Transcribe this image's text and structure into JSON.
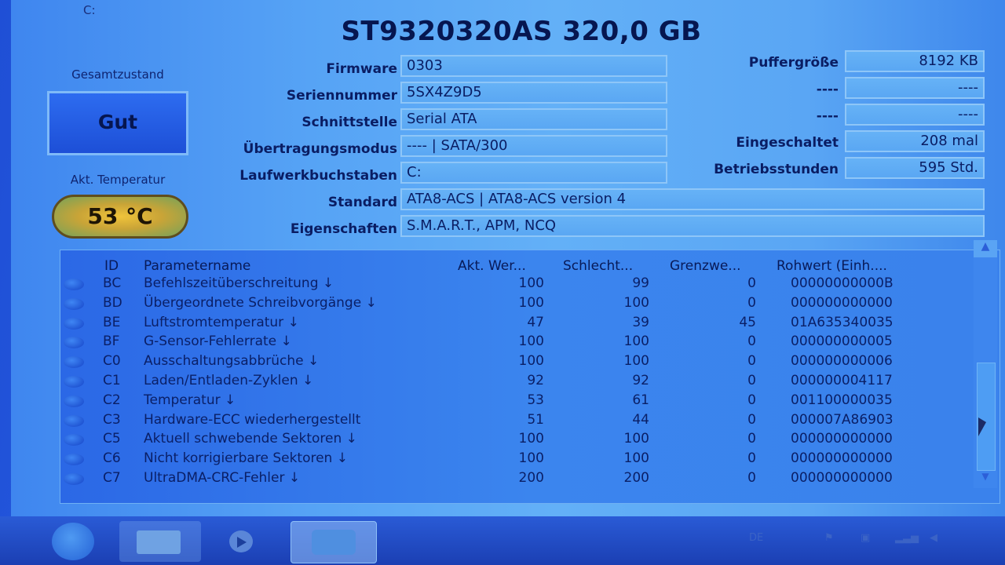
{
  "window": {
    "drive_letter_tab": "C:"
  },
  "drive": {
    "title": "ST9320320AS 320,0 GB"
  },
  "health": {
    "label": "Gesamtzustand",
    "status": "Gut"
  },
  "temperature": {
    "label": "Akt. Temperatur",
    "value": "53 °C"
  },
  "info": {
    "firmware": {
      "label": "Firmware",
      "value": "0303"
    },
    "serial": {
      "label": "Seriennummer",
      "value": "5SX4Z9D5"
    },
    "interface": {
      "label": "Schnittstelle",
      "value": "Serial ATA"
    },
    "transfer_mode": {
      "label": "Übertragungsmodus",
      "value": "---- | SATA/300"
    },
    "drive_letters": {
      "label": "Laufwerkbuchstaben",
      "value": "C:"
    },
    "standard": {
      "label": "Standard",
      "value": "ATA8-ACS | ATA8-ACS version 4"
    },
    "features": {
      "label": "Eigenschaften",
      "value": "S.M.A.R.T., APM, NCQ"
    }
  },
  "info_right": {
    "buffer": {
      "label": "Puffergröße",
      "value": "8192 KB"
    },
    "blank1": {
      "label": "----",
      "value": "----"
    },
    "blank2": {
      "label": "----",
      "value": "----"
    },
    "power_on_count": {
      "label": "Eingeschaltet",
      "value": "208 mal"
    },
    "power_on_hours": {
      "label": "Betriebsstunden",
      "value": "595 Std."
    }
  },
  "smart": {
    "headers": {
      "id": "ID",
      "name": "Parametername",
      "current": "Akt. Wer...",
      "worst": "Schlecht...",
      "threshold": "Grenzwe...",
      "raw": "Rohwert (Einh...."
    },
    "rows": [
      {
        "id": "BC",
        "name": "Befehlszeitüberschreitung ↓",
        "current": "100",
        "worst": "99",
        "threshold": "0",
        "raw": "00000000000B"
      },
      {
        "id": "BD",
        "name": "Übergeordnete Schreibvorgänge ↓",
        "current": "100",
        "worst": "100",
        "threshold": "0",
        "raw": "000000000000"
      },
      {
        "id": "BE",
        "name": "Luftstromtemperatur ↓",
        "current": "47",
        "worst": "39",
        "threshold": "45",
        "raw": "01A635340035"
      },
      {
        "id": "BF",
        "name": "G-Sensor-Fehlerrate ↓",
        "current": "100",
        "worst": "100",
        "threshold": "0",
        "raw": "000000000005"
      },
      {
        "id": "C0",
        "name": "Ausschaltungsabbrüche ↓",
        "current": "100",
        "worst": "100",
        "threshold": "0",
        "raw": "000000000006"
      },
      {
        "id": "C1",
        "name": "Laden/Entladen-Zyklen ↓",
        "current": "92",
        "worst": "92",
        "threshold": "0",
        "raw": "000000004117"
      },
      {
        "id": "C2",
        "name": "Temperatur ↓",
        "current": "53",
        "worst": "61",
        "threshold": "0",
        "raw": "001100000035"
      },
      {
        "id": "C3",
        "name": "Hardware-ECC wiederhergestellt",
        "current": "51",
        "worst": "44",
        "threshold": "0",
        "raw": "000007A86903"
      },
      {
        "id": "C5",
        "name": "Aktuell schwebende Sektoren ↓",
        "current": "100",
        "worst": "100",
        "threshold": "0",
        "raw": "000000000000"
      },
      {
        "id": "C6",
        "name": "Nicht korrigierbare Sektoren ↓",
        "current": "100",
        "worst": "100",
        "threshold": "0",
        "raw": "000000000000"
      },
      {
        "id": "C7",
        "name": "UltraDMA-CRC-Fehler ↓",
        "current": "200",
        "worst": "200",
        "threshold": "0",
        "raw": "000000000000"
      }
    ]
  },
  "scrollbar": {
    "up_icon": "▲",
    "down_icon": "▼"
  },
  "taskbar": {
    "tray_lang": "DE"
  },
  "colors": {
    "health_good": "#2d6cf0",
    "temp_gauge": "#f0c33a",
    "status_dot": "#2a5fe0"
  }
}
